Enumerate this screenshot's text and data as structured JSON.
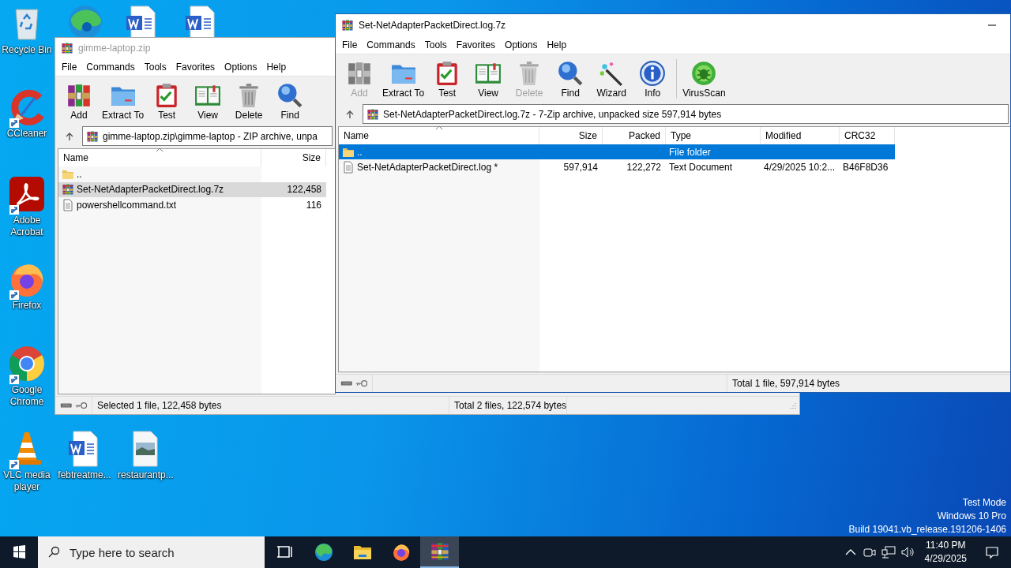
{
  "desktop_icons": [
    {
      "kind": "recycle-bin",
      "label": "Recycle Bin",
      "shortcut": false
    },
    {
      "kind": "edge",
      "shortcut": false
    },
    {
      "kind": "word",
      "shortcut": false
    },
    {
      "kind": "word",
      "shortcut": false
    },
    {
      "kind": "ccleaner",
      "label": "CCleaner",
      "shortcut": true
    },
    {
      "kind": "acrobat",
      "label": "Adobe Acrobat",
      "shortcut": true
    },
    {
      "kind": "firefox",
      "label": "Firefox",
      "shortcut": true
    },
    {
      "kind": "chrome",
      "label": "Google Chrome",
      "shortcut": true
    },
    {
      "kind": "vlc",
      "label": "VLC media player",
      "shortcut": true
    },
    {
      "kind": "word",
      "label": "febtreatme...",
      "shortcut": false
    },
    {
      "kind": "image",
      "label": "restaurantp...",
      "shortcut": false
    }
  ],
  "back_window": {
    "title": "gimme-laptop.zip",
    "active": false,
    "menu": [
      "File",
      "Commands",
      "Tools",
      "Favorites",
      "Options",
      "Help"
    ],
    "toolbar_groups": [
      {
        "buttons": [
          {
            "kind": "add",
            "label": "Add",
            "disabled": false
          },
          {
            "kind": "extract",
            "label": "Extract To",
            "disabled": false
          },
          {
            "kind": "test",
            "label": "Test",
            "disabled": false
          },
          {
            "kind": "view",
            "label": "View",
            "disabled": false
          },
          {
            "kind": "delete",
            "label": "Delete",
            "disabled": false
          },
          {
            "kind": "find",
            "label": "Find",
            "disabled": false
          }
        ]
      }
    ],
    "address": "gimme-laptop.zip\\gimme-laptop - ZIP archive, unpa",
    "columns": [
      {
        "label": "Name",
        "sorted": true
      },
      {
        "label": "Size",
        "sorted": false
      }
    ],
    "rows": [
      {
        "kind": "folder",
        "name": "..",
        "selected": false
      },
      {
        "kind": "archive",
        "name": "Set-NetAdapterPacketDirect.log.7z",
        "size": "122,458",
        "selected": true
      },
      {
        "kind": "text",
        "name": "powershellcommand.txt",
        "size": "116",
        "selected": false
      }
    ],
    "status": [
      "Selected 1 file, 122,458 bytes",
      "Total 2 files, 122,574 bytes"
    ]
  },
  "front_window": {
    "title": "Set-NetAdapterPacketDirect.log.7z",
    "active": true,
    "menu": [
      "File",
      "Commands",
      "Tools",
      "Favorites",
      "Options",
      "Help"
    ],
    "toolbar_groups": [
      {
        "buttons": [
          {
            "kind": "add",
            "label": "Add",
            "disabled": true
          },
          {
            "kind": "extract",
            "label": "Extract To",
            "disabled": false
          },
          {
            "kind": "test",
            "label": "Test",
            "disabled": false
          },
          {
            "kind": "view",
            "label": "View",
            "disabled": false
          },
          {
            "kind": "delete",
            "label": "Delete",
            "disabled": true
          },
          {
            "kind": "find",
            "label": "Find",
            "disabled": false
          },
          {
            "kind": "wizard",
            "label": "Wizard",
            "disabled": false
          },
          {
            "kind": "info",
            "label": "Info",
            "disabled": false
          }
        ]
      },
      {
        "buttons": [
          {
            "kind": "virusscan",
            "label": "VirusScan",
            "disabled": false
          }
        ]
      }
    ],
    "address": "Set-NetAdapterPacketDirect.log.7z - 7-Zip archive, unpacked size 597,914 bytes",
    "columns": [
      {
        "label": "Name",
        "sorted": true
      },
      {
        "label": "Size",
        "sorted": false
      },
      {
        "label": "Packed",
        "sorted": false
      },
      {
        "label": "Type",
        "sorted": false
      },
      {
        "label": "Modified",
        "sorted": false
      },
      {
        "label": "CRC32",
        "sorted": false
      }
    ],
    "rows": [
      {
        "kind": "folder",
        "name": "..",
        "type": "File folder",
        "selected": true
      },
      {
        "kind": "text",
        "name": "Set-NetAdapterPacketDirect.log *",
        "size": "597,914",
        "packed": "122,272",
        "type": "Text Document",
        "modified": "4/29/2025 10:2...",
        "crc32": "B46F8D36",
        "selected": false
      }
    ],
    "status": [
      "Total 1 file, 597,914 bytes"
    ]
  },
  "system_text": [
    "Test Mode",
    "Windows 10 Pro",
    "Build 19041.vb_release.191206-1406"
  ],
  "taskbar": {
    "search_placeholder": "Type here to search",
    "apps": [
      {
        "kind": "task-view",
        "active": false
      },
      {
        "kind": "edge",
        "active": false
      },
      {
        "kind": "explorer",
        "active": false
      },
      {
        "kind": "firefox",
        "active": false
      },
      {
        "kind": "winrar",
        "active": true
      }
    ],
    "time": "11:40 PM",
    "date": "4/29/2025"
  }
}
